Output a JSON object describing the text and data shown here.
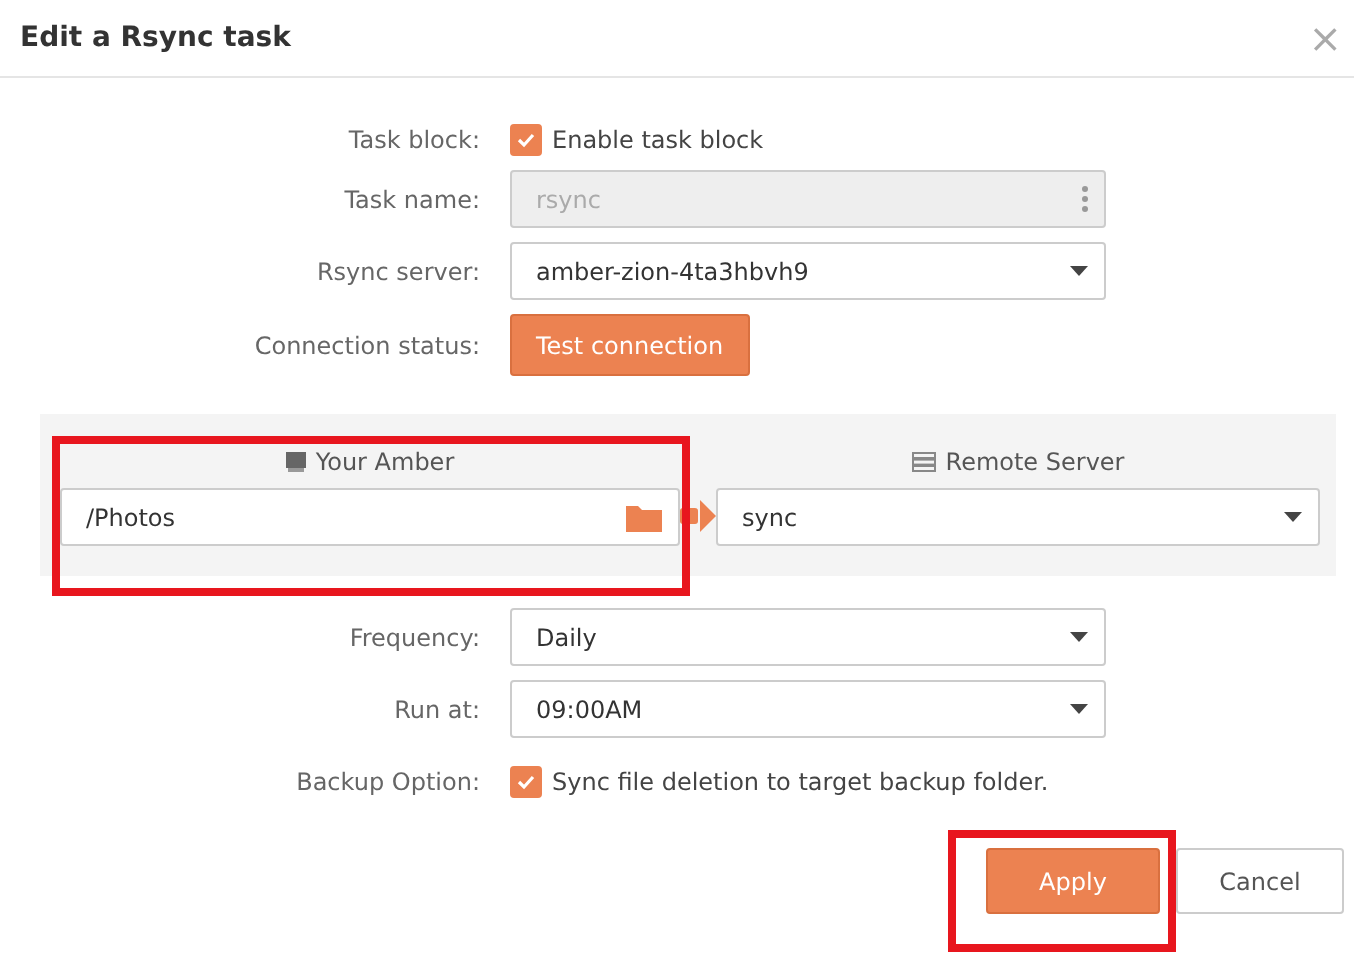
{
  "dialog": {
    "title": "Edit a Rsync task",
    "close": "×"
  },
  "task_block": {
    "label": "Task block:",
    "checkbox_label": "Enable task block",
    "checked": true
  },
  "task_name": {
    "label": "Task name:",
    "value": "rsync",
    "disabled": true
  },
  "rsync_server": {
    "label": "Rsync server:",
    "value": "amber-zion-4ta3hbvh9"
  },
  "connection_status": {
    "label": "Connection status:",
    "button": "Test connection"
  },
  "source": {
    "heading": "Your Amber",
    "value": "/Photos"
  },
  "destination": {
    "heading": "Remote Server",
    "value": "sync"
  },
  "frequency": {
    "label": "Frequency:",
    "value": "Daily"
  },
  "run_at": {
    "label": "Run at:",
    "value": "09:00AM"
  },
  "backup_option": {
    "label": "Backup Option:",
    "checkbox_label": "Sync file deletion to target backup folder.",
    "checked": true
  },
  "buttons": [
    {
      "label": "Apply",
      "kind": "primary"
    },
    {
      "label": "Cancel",
      "kind": "secondary"
    }
  ]
}
